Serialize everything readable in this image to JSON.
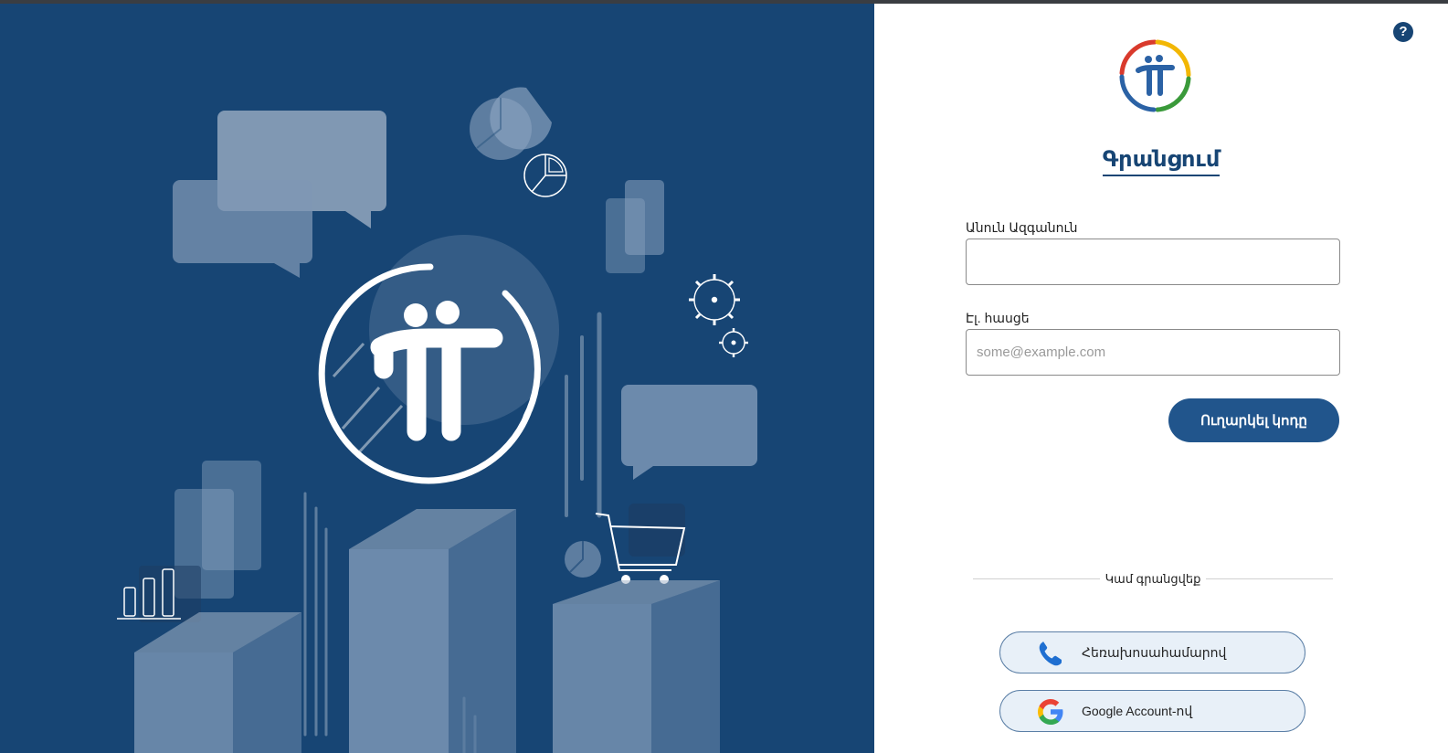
{
  "form": {
    "title": "Գրանցում",
    "name_label": "Անուն Ազգանուն",
    "name_value": "",
    "email_label": "Էլ. հասցե",
    "email_placeholder": "some@example.com",
    "send_button": "Ուղարկել կոդը"
  },
  "help": {
    "label": "?"
  },
  "alt": {
    "divider_text": "Կամ գրանցվեք",
    "phone_button": "Հեռախոսահամարով",
    "google_button": "Google Account-ով"
  },
  "colors": {
    "brand_blue": "#174574",
    "button_blue": "#21558c",
    "logo_red": "#d93a2c",
    "logo_yellow": "#f2b705",
    "logo_green": "#3a9a3a",
    "logo_blue": "#2b62a5"
  },
  "icons": [
    "help-icon",
    "brand-logo",
    "phone-icon",
    "google-icon",
    "chat-bubble-icon",
    "pie-chart-icon",
    "gear-icon",
    "cart-icon",
    "bar-chart-icon"
  ]
}
